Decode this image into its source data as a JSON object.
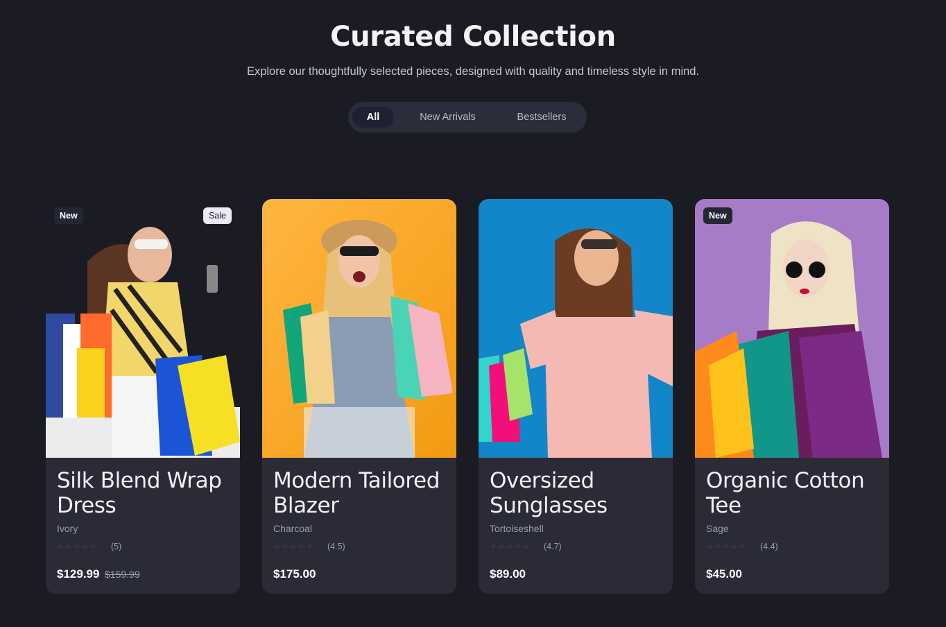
{
  "header": {
    "title": "Curated Collection",
    "subtitle": "Explore our thoughtfully selected pieces, designed with quality and timeless style in mind."
  },
  "tabs": [
    {
      "label": "All",
      "active": true
    },
    {
      "label": "New Arrivals",
      "active": false
    },
    {
      "label": "Bestsellers",
      "active": false
    }
  ],
  "products": [
    {
      "name": "Silk Blend Wrap Dress",
      "color": "Ivory",
      "rating": "(5)",
      "price": "$129.99",
      "old_price": "$159.99",
      "badges": {
        "new": "New",
        "sale": "Sale"
      },
      "image_bg": "#1a1b23"
    },
    {
      "name": "Modern Tailored Blazer",
      "color": "Charcoal",
      "rating": "(4.5)",
      "price": "$175.00",
      "image_bg": "#f6a623"
    },
    {
      "name": "Oversized Sunglasses",
      "color": "Tortoiseshell",
      "rating": "(4.7)",
      "price": "$89.00",
      "image_bg": "#1386c9"
    },
    {
      "name": "Organic Cotton Tee",
      "color": "Sage",
      "rating": "(4.4)",
      "price": "$45.00",
      "badges": {
        "new": "New"
      },
      "image_bg": "#a77cc6"
    }
  ],
  "stars": "★★★★★",
  "colors": {
    "background": "#1a1b23",
    "card": "#2a2b37",
    "tab_bar": "#2c2d3b"
  }
}
